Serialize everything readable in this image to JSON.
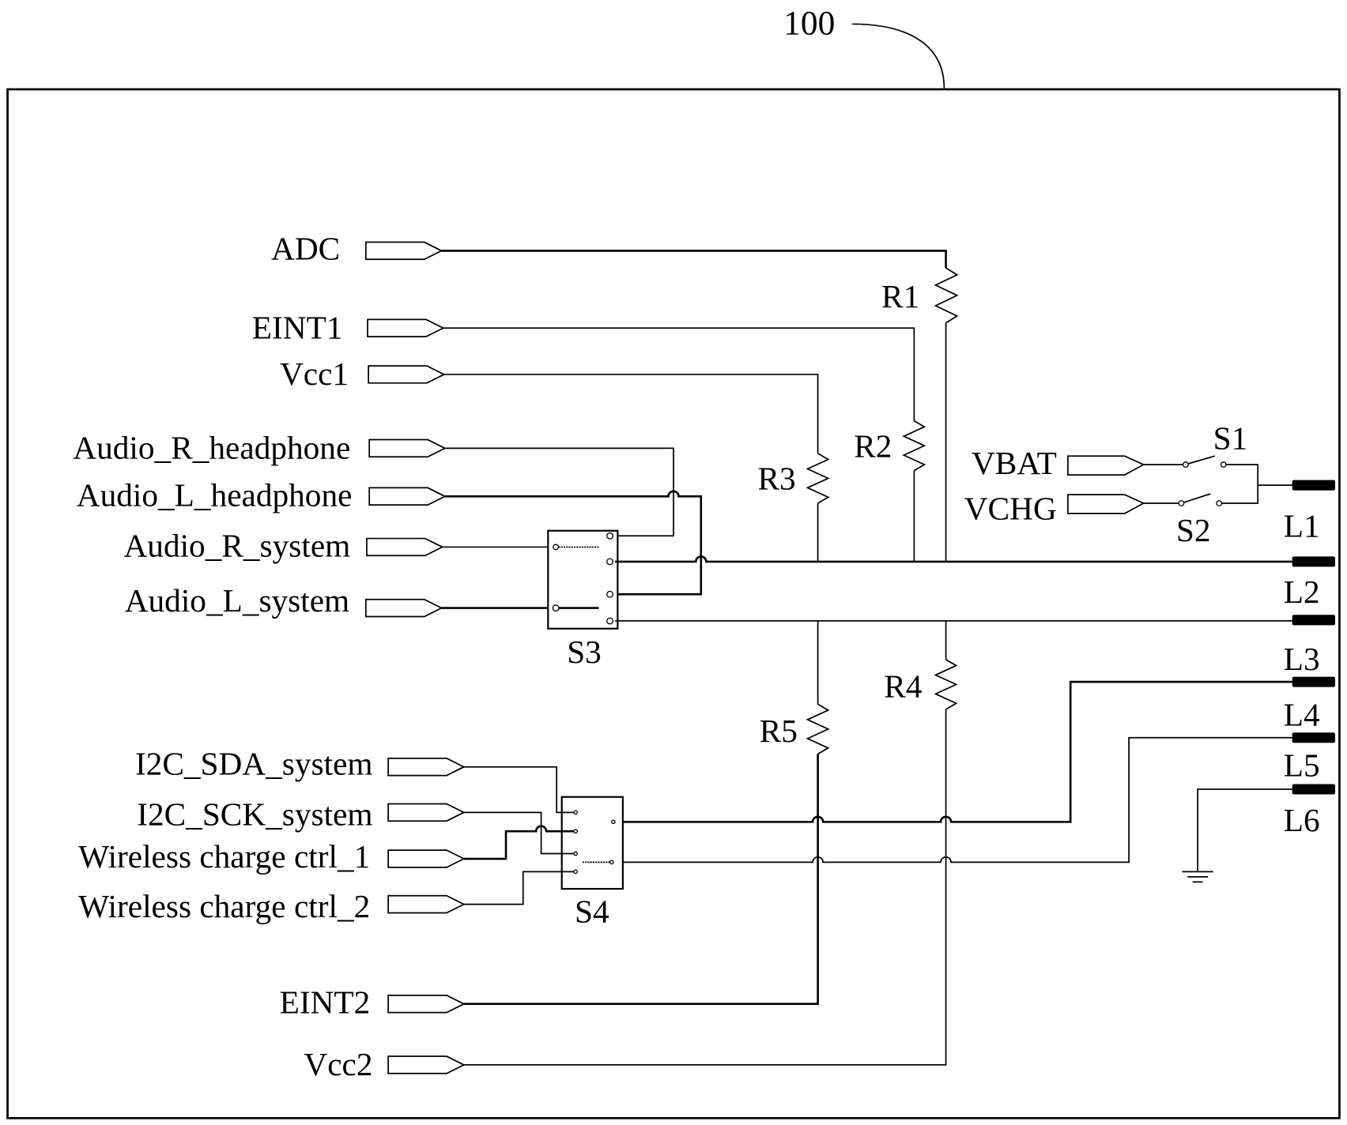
{
  "figure": {
    "reference_number": "100"
  },
  "ports_left": [
    {
      "id": "adc",
      "label": "ADC"
    },
    {
      "id": "eint1",
      "label": "EINT1"
    },
    {
      "id": "vcc1",
      "label": "Vcc1"
    },
    {
      "id": "audio-r-headphone",
      "label": "Audio_R_headphone"
    },
    {
      "id": "audio-l-headphone",
      "label": "Audio_L_headphone"
    },
    {
      "id": "audio-r-system",
      "label": "Audio_R_system"
    },
    {
      "id": "audio-l-system",
      "label": "Audio_L_system"
    },
    {
      "id": "i2c-sda-system",
      "label": "I2C_SDA_system"
    },
    {
      "id": "i2c-sck-system",
      "label": "I2C_SCK_system"
    },
    {
      "id": "wireless-charge-ctrl-1",
      "label": "Wireless charge ctrl_1"
    },
    {
      "id": "wireless-charge-ctrl-2",
      "label": "Wireless charge ctrl_2"
    },
    {
      "id": "eint2",
      "label": "EINT2"
    },
    {
      "id": "vcc2",
      "label": "Vcc2"
    }
  ],
  "ports_right": [
    {
      "id": "vbat",
      "label": "VBAT"
    },
    {
      "id": "vchg",
      "label": "VCHG"
    }
  ],
  "resistors": [
    {
      "id": "r1",
      "label": "R1"
    },
    {
      "id": "r2",
      "label": "R2"
    },
    {
      "id": "r3",
      "label": "R3"
    },
    {
      "id": "r4",
      "label": "R4"
    },
    {
      "id": "r5",
      "label": "R5"
    }
  ],
  "switches": [
    {
      "id": "s1",
      "label": "S1"
    },
    {
      "id": "s2",
      "label": "S2"
    },
    {
      "id": "s3",
      "label": "S3"
    },
    {
      "id": "s4",
      "label": "S4"
    }
  ],
  "pads": [
    {
      "id": "l1",
      "label": "L1"
    },
    {
      "id": "l2",
      "label": "L2"
    },
    {
      "id": "l3",
      "label": "L3"
    },
    {
      "id": "l4",
      "label": "L4"
    },
    {
      "id": "l5",
      "label": "L5"
    },
    {
      "id": "l6",
      "label": "L6"
    }
  ]
}
